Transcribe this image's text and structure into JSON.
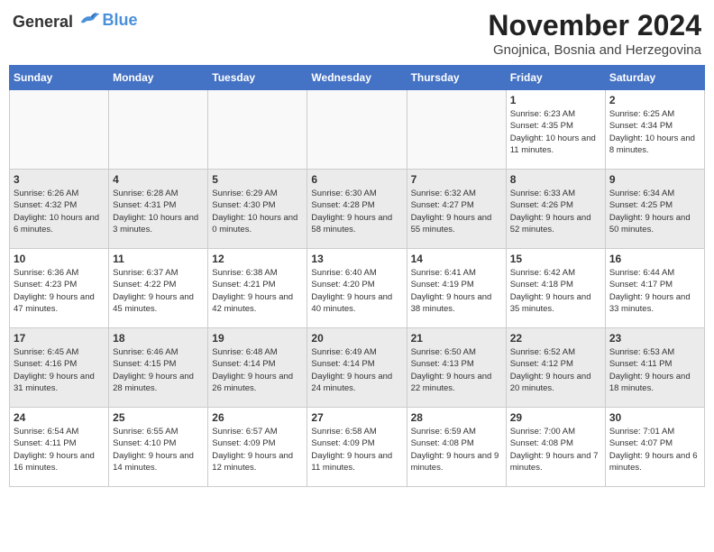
{
  "header": {
    "logo_general": "General",
    "logo_blue": "Blue",
    "month_title": "November 2024",
    "subtitle": "Gnojnica, Bosnia and Herzegovina"
  },
  "days_of_week": [
    "Sunday",
    "Monday",
    "Tuesday",
    "Wednesday",
    "Thursday",
    "Friday",
    "Saturday"
  ],
  "weeks": [
    {
      "shaded": false,
      "days": [
        {
          "number": "",
          "info": ""
        },
        {
          "number": "",
          "info": ""
        },
        {
          "number": "",
          "info": ""
        },
        {
          "number": "",
          "info": ""
        },
        {
          "number": "",
          "info": ""
        },
        {
          "number": "1",
          "info": "Sunrise: 6:23 AM\nSunset: 4:35 PM\nDaylight: 10 hours\nand 11 minutes."
        },
        {
          "number": "2",
          "info": "Sunrise: 6:25 AM\nSunset: 4:34 PM\nDaylight: 10 hours\nand 8 minutes."
        }
      ]
    },
    {
      "shaded": true,
      "days": [
        {
          "number": "3",
          "info": "Sunrise: 6:26 AM\nSunset: 4:32 PM\nDaylight: 10 hours\nand 6 minutes."
        },
        {
          "number": "4",
          "info": "Sunrise: 6:28 AM\nSunset: 4:31 PM\nDaylight: 10 hours\nand 3 minutes."
        },
        {
          "number": "5",
          "info": "Sunrise: 6:29 AM\nSunset: 4:30 PM\nDaylight: 10 hours\nand 0 minutes."
        },
        {
          "number": "6",
          "info": "Sunrise: 6:30 AM\nSunset: 4:28 PM\nDaylight: 9 hours\nand 58 minutes."
        },
        {
          "number": "7",
          "info": "Sunrise: 6:32 AM\nSunset: 4:27 PM\nDaylight: 9 hours\nand 55 minutes."
        },
        {
          "number": "8",
          "info": "Sunrise: 6:33 AM\nSunset: 4:26 PM\nDaylight: 9 hours\nand 52 minutes."
        },
        {
          "number": "9",
          "info": "Sunrise: 6:34 AM\nSunset: 4:25 PM\nDaylight: 9 hours\nand 50 minutes."
        }
      ]
    },
    {
      "shaded": false,
      "days": [
        {
          "number": "10",
          "info": "Sunrise: 6:36 AM\nSunset: 4:23 PM\nDaylight: 9 hours\nand 47 minutes."
        },
        {
          "number": "11",
          "info": "Sunrise: 6:37 AM\nSunset: 4:22 PM\nDaylight: 9 hours\nand 45 minutes."
        },
        {
          "number": "12",
          "info": "Sunrise: 6:38 AM\nSunset: 4:21 PM\nDaylight: 9 hours\nand 42 minutes."
        },
        {
          "number": "13",
          "info": "Sunrise: 6:40 AM\nSunset: 4:20 PM\nDaylight: 9 hours\nand 40 minutes."
        },
        {
          "number": "14",
          "info": "Sunrise: 6:41 AM\nSunset: 4:19 PM\nDaylight: 9 hours\nand 38 minutes."
        },
        {
          "number": "15",
          "info": "Sunrise: 6:42 AM\nSunset: 4:18 PM\nDaylight: 9 hours\nand 35 minutes."
        },
        {
          "number": "16",
          "info": "Sunrise: 6:44 AM\nSunset: 4:17 PM\nDaylight: 9 hours\nand 33 minutes."
        }
      ]
    },
    {
      "shaded": true,
      "days": [
        {
          "number": "17",
          "info": "Sunrise: 6:45 AM\nSunset: 4:16 PM\nDaylight: 9 hours\nand 31 minutes."
        },
        {
          "number": "18",
          "info": "Sunrise: 6:46 AM\nSunset: 4:15 PM\nDaylight: 9 hours\nand 28 minutes."
        },
        {
          "number": "19",
          "info": "Sunrise: 6:48 AM\nSunset: 4:14 PM\nDaylight: 9 hours\nand 26 minutes."
        },
        {
          "number": "20",
          "info": "Sunrise: 6:49 AM\nSunset: 4:14 PM\nDaylight: 9 hours\nand 24 minutes."
        },
        {
          "number": "21",
          "info": "Sunrise: 6:50 AM\nSunset: 4:13 PM\nDaylight: 9 hours\nand 22 minutes."
        },
        {
          "number": "22",
          "info": "Sunrise: 6:52 AM\nSunset: 4:12 PM\nDaylight: 9 hours\nand 20 minutes."
        },
        {
          "number": "23",
          "info": "Sunrise: 6:53 AM\nSunset: 4:11 PM\nDaylight: 9 hours\nand 18 minutes."
        }
      ]
    },
    {
      "shaded": false,
      "days": [
        {
          "number": "24",
          "info": "Sunrise: 6:54 AM\nSunset: 4:11 PM\nDaylight: 9 hours\nand 16 minutes."
        },
        {
          "number": "25",
          "info": "Sunrise: 6:55 AM\nSunset: 4:10 PM\nDaylight: 9 hours\nand 14 minutes."
        },
        {
          "number": "26",
          "info": "Sunrise: 6:57 AM\nSunset: 4:09 PM\nDaylight: 9 hours\nand 12 minutes."
        },
        {
          "number": "27",
          "info": "Sunrise: 6:58 AM\nSunset: 4:09 PM\nDaylight: 9 hours\nand 11 minutes."
        },
        {
          "number": "28",
          "info": "Sunrise: 6:59 AM\nSunset: 4:08 PM\nDaylight: 9 hours\nand 9 minutes."
        },
        {
          "number": "29",
          "info": "Sunrise: 7:00 AM\nSunset: 4:08 PM\nDaylight: 9 hours\nand 7 minutes."
        },
        {
          "number": "30",
          "info": "Sunrise: 7:01 AM\nSunset: 4:07 PM\nDaylight: 9 hours\nand 6 minutes."
        }
      ]
    }
  ]
}
